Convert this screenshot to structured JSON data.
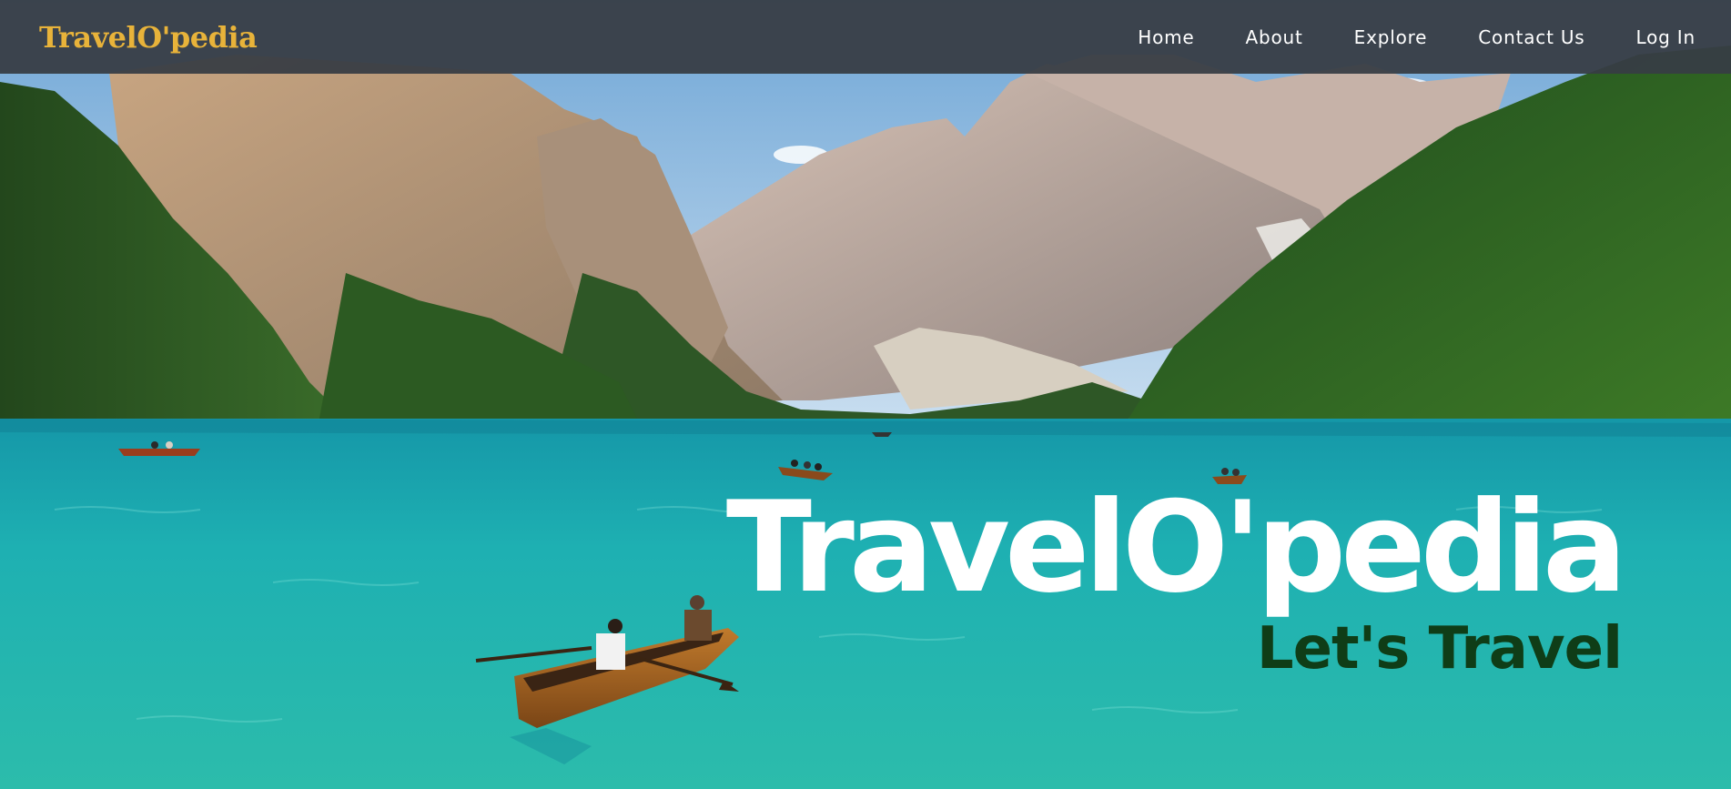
{
  "navbar": {
    "brand": "TravelO'pedia",
    "links": [
      {
        "label": "Home"
      },
      {
        "label": "About"
      },
      {
        "label": "Explore"
      },
      {
        "label": "Contact Us"
      },
      {
        "label": "Log In"
      }
    ]
  },
  "hero": {
    "title": "TravelO'pedia",
    "subtitle": "Let's Travel",
    "image_description": "mountain-lake-with-rowboats"
  },
  "colors": {
    "brand": "#e8b33a",
    "navbar_bg": "#373d44",
    "hero_title": "#ffffff",
    "hero_subtitle": "#0f3d17",
    "lake": "#1aa7a6"
  }
}
